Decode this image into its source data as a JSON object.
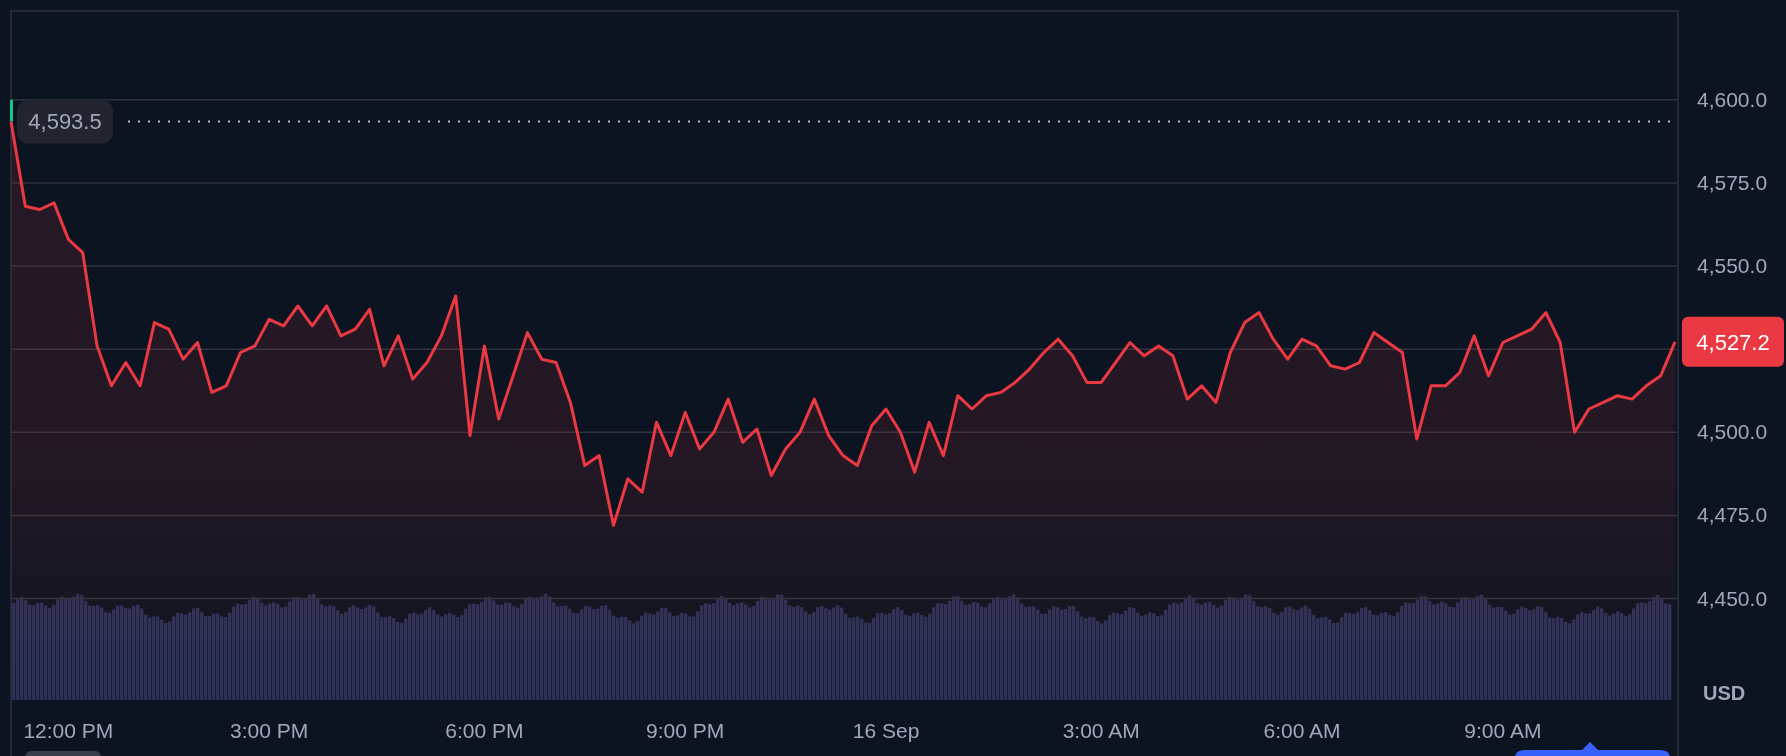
{
  "chart": {
    "chart_data": {
      "type": "area",
      "categories": [
        null,
        null,
        null,
        null,
        "12:00 PM",
        null,
        null,
        null,
        null,
        null,
        null,
        null,
        null,
        null,
        null,
        null,
        null,
        null,
        "3:00 PM",
        null,
        null,
        null,
        null,
        null,
        null,
        null,
        null,
        null,
        null,
        null,
        null,
        null,
        null,
        "6:00 PM",
        null,
        null,
        null,
        null,
        null,
        null,
        null,
        null,
        null,
        null,
        null,
        null,
        null,
        "9:00 PM",
        null,
        null,
        null,
        null,
        null,
        null,
        null,
        null,
        null,
        null,
        null,
        null,
        null,
        "16 Sep",
        null,
        null,
        null,
        null,
        null,
        null,
        null,
        null,
        null,
        null,
        null,
        null,
        null,
        null,
        "3:00 AM",
        null,
        null,
        null,
        null,
        null,
        null,
        null,
        null,
        null,
        null,
        null,
        null,
        null,
        "6:00 AM",
        null,
        null,
        null,
        null,
        null,
        null,
        null,
        null,
        null,
        null,
        null,
        null,
        null,
        "9:00 AM",
        null,
        null,
        null,
        null,
        null,
        null,
        null,
        null,
        null,
        null,
        null,
        null
      ],
      "grid": true,
      "ylim": [
        4419.5,
        4626.7
      ],
      "series": [
        {
          "color": "#ea3943",
          "values": [
            4593.5,
            4568,
            4567,
            4569,
            4558,
            4554,
            4526,
            4514,
            4521,
            4514,
            4533,
            4531,
            4522,
            4527,
            4512,
            4514,
            4524,
            4526,
            4534,
            4532,
            4538,
            4532,
            4538,
            4529,
            4531,
            4537,
            4520,
            4529,
            4516,
            4521,
            4529,
            4541,
            4499,
            4526,
            4504,
            4517,
            4530,
            4522,
            4521,
            4509,
            4490,
            4493,
            4472,
            4486,
            4482,
            4503,
            4493,
            4506,
            4495,
            4500,
            4510,
            4497,
            4501,
            4487,
            4495,
            4500,
            4510,
            4499,
            4493,
            4490,
            4502,
            4507,
            4500,
            4488,
            4503,
            4493,
            4511,
            4507,
            4511,
            4512,
            4515,
            4519,
            4524,
            4528,
            4523,
            4515,
            4515,
            4521,
            4527,
            4523,
            4526,
            4523,
            4510,
            4514,
            4509,
            4524,
            4533,
            4536,
            4528,
            4522,
            4528,
            4526,
            4520,
            4519,
            4521,
            4530,
            4527,
            4524,
            4498,
            4514,
            4514,
            4518,
            4529,
            4517,
            4527,
            4529,
            4531,
            4536,
            4527,
            4500,
            4507,
            4509,
            4511,
            4510,
            4514,
            4517,
            4527.2
          ]
        }
      ],
      "yticks": [
        {
          "value": 4450,
          "label": "4,450.0"
        },
        {
          "value": 4475,
          "label": "4,475.0"
        },
        {
          "value": 4500,
          "label": "4,500.0"
        },
        {
          "value": 4550,
          "label": "4,550.0"
        },
        {
          "value": 4575,
          "label": "4,575.0"
        },
        {
          "value": 4600,
          "label": "4,600.0"
        }
      ]
    },
    "open_price": "4,593.5",
    "last_price": "4,527.2",
    "currency": "USD"
  }
}
